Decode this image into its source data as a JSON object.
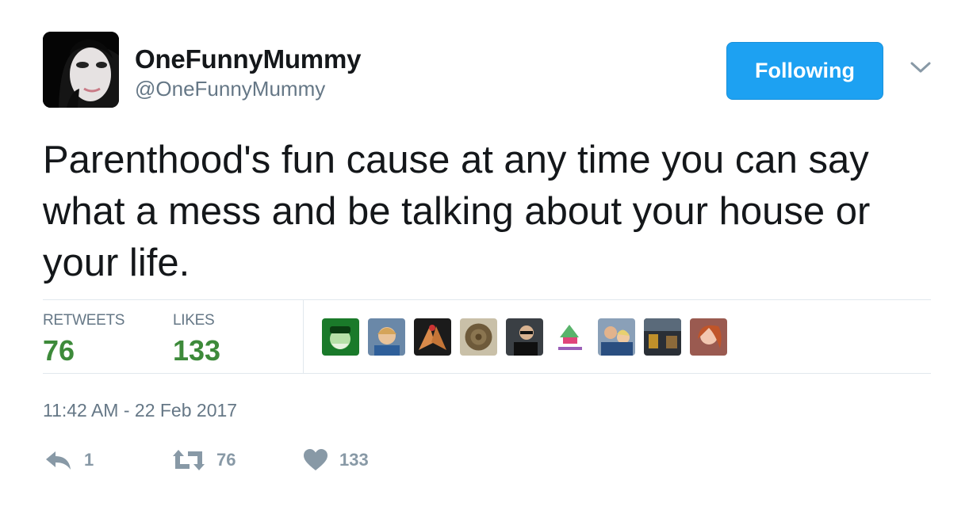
{
  "user": {
    "display_name": "OneFunnyMummy",
    "handle": "@OneFunnyMummy",
    "avatar_icon": "profile-avatar"
  },
  "follow_button": {
    "label": "Following",
    "color": "#1da1f2"
  },
  "menu": {
    "icon": "chevron-down-icon"
  },
  "tweet": {
    "text": "Parenthood's fun cause at any time you can say what a mess and be talking about your house or your life."
  },
  "stats": {
    "retweets_label": "RETWEETS",
    "retweets_value": "76",
    "likes_label": "LIKES",
    "likes_value": "133",
    "value_color": "#3d8a3a"
  },
  "likers": [
    {
      "icon": "liker-avatar"
    },
    {
      "icon": "liker-avatar"
    },
    {
      "icon": "liker-avatar"
    },
    {
      "icon": "liker-avatar"
    },
    {
      "icon": "liker-avatar"
    },
    {
      "icon": "liker-avatar"
    },
    {
      "icon": "liker-avatar"
    },
    {
      "icon": "liker-avatar"
    },
    {
      "icon": "liker-avatar"
    }
  ],
  "timestamp": "11:42 AM - 22 Feb 2017",
  "actions": {
    "reply_count": "1",
    "retweet_count": "76",
    "like_count": "133",
    "icon_color": "#8899a6"
  }
}
